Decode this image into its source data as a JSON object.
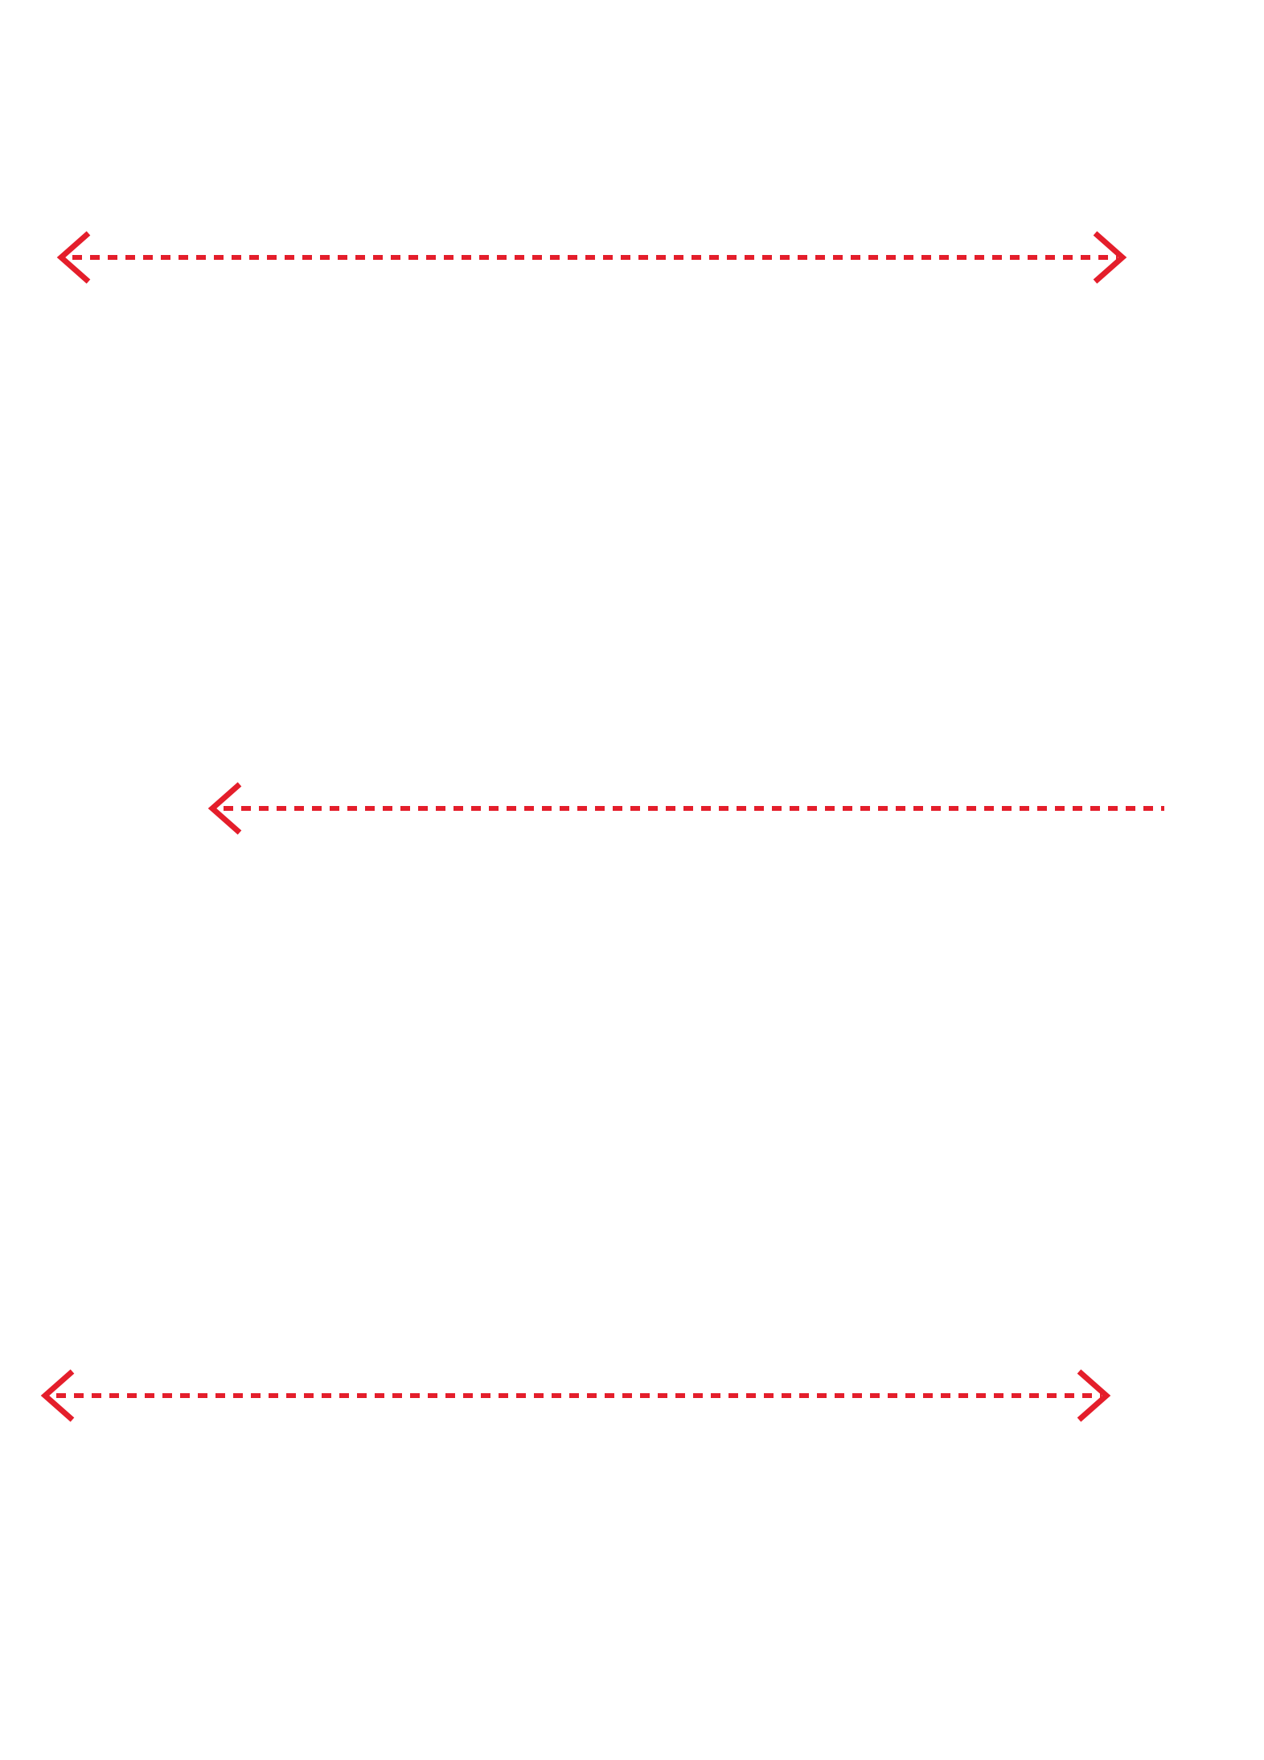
{
  "diagram": {
    "stroke_color": "#e41e2b",
    "background_color": "#ffffff",
    "arrows": [
      {
        "id": "arrow-1",
        "style": "dashed",
        "heads": [
          "left",
          "right"
        ]
      },
      {
        "id": "arrow-2",
        "style": "dashed",
        "heads": [
          "left"
        ]
      },
      {
        "id": "arrow-3",
        "style": "dashed",
        "heads": [
          "left",
          "right"
        ]
      }
    ]
  }
}
